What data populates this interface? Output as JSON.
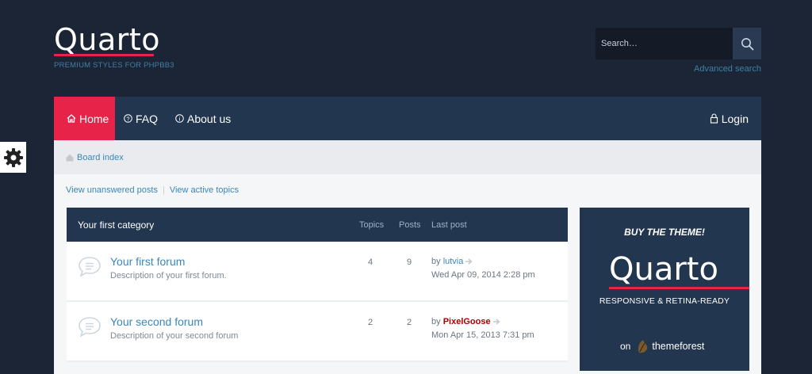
{
  "header": {
    "logo": "Quarto",
    "tagline": "PREMIUM STYLES FOR PHPBB3",
    "search_placeholder": "Search…",
    "advanced_search": "Advanced search"
  },
  "nav": {
    "items": [
      {
        "label": "Home",
        "icon": "home-icon"
      },
      {
        "label": "FAQ",
        "icon": "question-icon"
      },
      {
        "label": "About us",
        "icon": "info-icon"
      }
    ],
    "login": "Login"
  },
  "breadcrumb": {
    "label": "Board index"
  },
  "quick_links": {
    "unanswered": "View unanswered posts",
    "active": "View active topics"
  },
  "forumlist": {
    "category": "Your first category",
    "col_topics": "Topics",
    "col_posts": "Posts",
    "col_last": "Last post",
    "rows": [
      {
        "title": "Your first forum",
        "desc": "Description of your first forum.",
        "topics": "4",
        "posts": "9",
        "by": "by",
        "user": "lutvia",
        "user_color": "#3b86b8",
        "date": "Wed Apr 09, 2014 2:28 pm"
      },
      {
        "title": "Your second forum",
        "desc": "Description of your second forum",
        "topics": "2",
        "posts": "2",
        "by": "by",
        "user": "PixelGoose",
        "user_color": "#aa0000",
        "date": "Mon Apr 15, 2013 7:31 pm"
      }
    ]
  },
  "ad": {
    "buy": "BUY THE THEME!",
    "logo": "Quarto",
    "subtitle": "RESPONSIVE & RETINA-READY",
    "on": "on",
    "brand": "themeforest"
  },
  "colors": {
    "accent": "#e8234a",
    "nav_bg": "#22364f",
    "link": "#3b86b8",
    "page_bg": "#1c2535"
  }
}
